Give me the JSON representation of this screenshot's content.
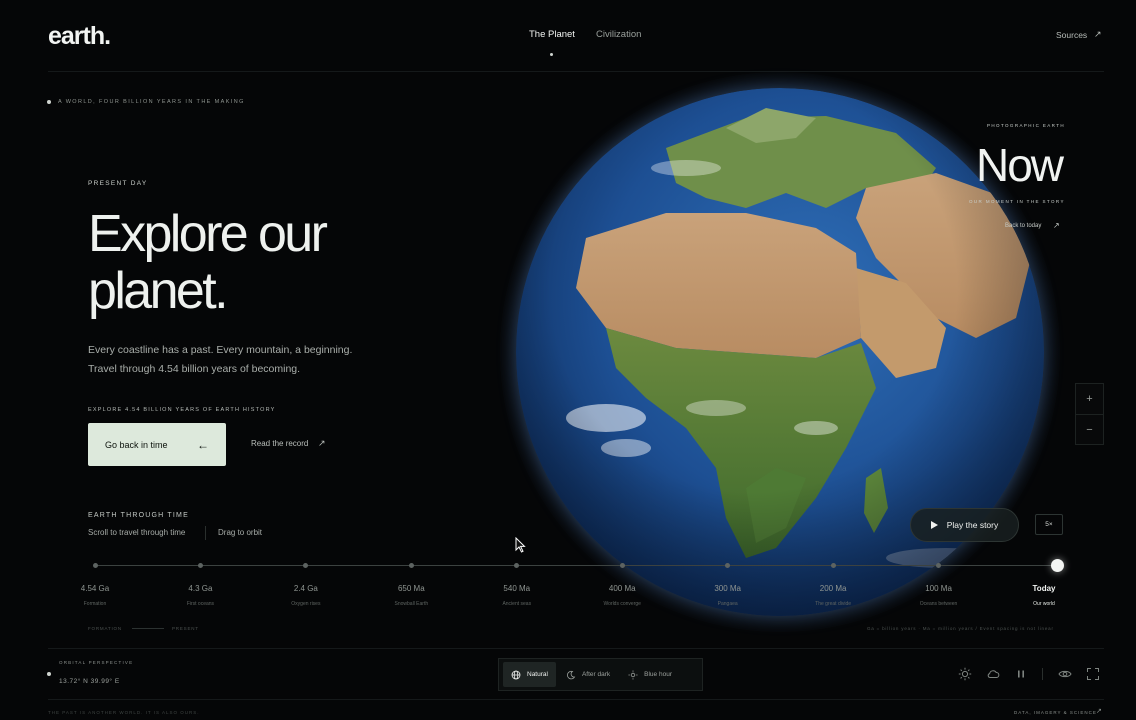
{
  "header": {
    "logo": "earth.",
    "nav": [
      {
        "label": "The Planet",
        "active": true
      },
      {
        "label": "Civilization",
        "active": false
      }
    ],
    "sources_label": "Sources",
    "arrow": "↗"
  },
  "hero": {
    "tagline": "A WORLD, FOUR BILLION YEARS IN THE MAKING",
    "eyebrow": "PRESENT DAY",
    "headline_line1": "Explore our",
    "headline_line2": "planet.",
    "desc_line1": "Every coastline has a past. Every mountain, a beginning.",
    "desc_line2": "Travel through 4.54 billion years of becoming.",
    "explore_label": "EXPLORE 4.54 BILLION YEARS OF EARTH HISTORY",
    "cta_label": "Go back in time",
    "cta_arrow": "←",
    "read_label": "Read the record",
    "read_arrow": "↗"
  },
  "panel": {
    "eyebrow": "PHOTOGRAPHIC EARTH",
    "big": "Now",
    "moment": "OUR MOMENT IN THE STORY",
    "back_label": "Back to today",
    "back_arrow": "↗",
    "zoom_in": "+",
    "zoom_out": "−",
    "play_label": "Play the story",
    "speed": "5×"
  },
  "timeline": {
    "title": "EARTH THROUGH TIME",
    "scroll_hint": "Scroll to travel through time",
    "drag_hint": "Drag to orbit",
    "progress": 1.0,
    "stops": [
      {
        "label": "4.54 Ga",
        "sub": "Formation"
      },
      {
        "label": "4.3 Ga",
        "sub": "First oceans"
      },
      {
        "label": "2.4 Ga",
        "sub": "Oxygen rises"
      },
      {
        "label": "650 Ma",
        "sub": "Snowball Earth"
      },
      {
        "label": "540 Ma",
        "sub": "Ancient seas"
      },
      {
        "label": "400 Ma",
        "sub": "Worlds converge"
      },
      {
        "label": "300 Ma",
        "sub": "Pangaea"
      },
      {
        "label": "200 Ma",
        "sub": "The great divide"
      },
      {
        "label": "100 Ma",
        "sub": "Oceans between"
      },
      {
        "label": "Today",
        "sub": "Our world",
        "active": true
      }
    ],
    "foot_left_a": "FORMATION",
    "foot_left_b": "PRESENT",
    "foot_right": "Ga = billion years · Ma = million years   /   Event spacing is not linear"
  },
  "bottom": {
    "orbital_label": "ORBITAL PERSPECTIVE",
    "coords": "13.72° N 39.99° E",
    "modes": [
      {
        "label": "Natural",
        "icon": "globe-icon",
        "active": true
      },
      {
        "label": "After dark",
        "icon": "moon-icon",
        "active": false
      },
      {
        "label": "Blue hour",
        "icon": "sun-dim-icon",
        "active": false
      }
    ],
    "footer_left": "THE PAST IS ANOTHER WORLD. IT IS ALSO OURS.",
    "footer_right": "DATA, IMAGERY & SCIENCE",
    "footer_arrow": "↗"
  },
  "colors": {
    "background": "#050607",
    "accent_button": "#dde9dc",
    "text_primary": "#eef1ee"
  }
}
